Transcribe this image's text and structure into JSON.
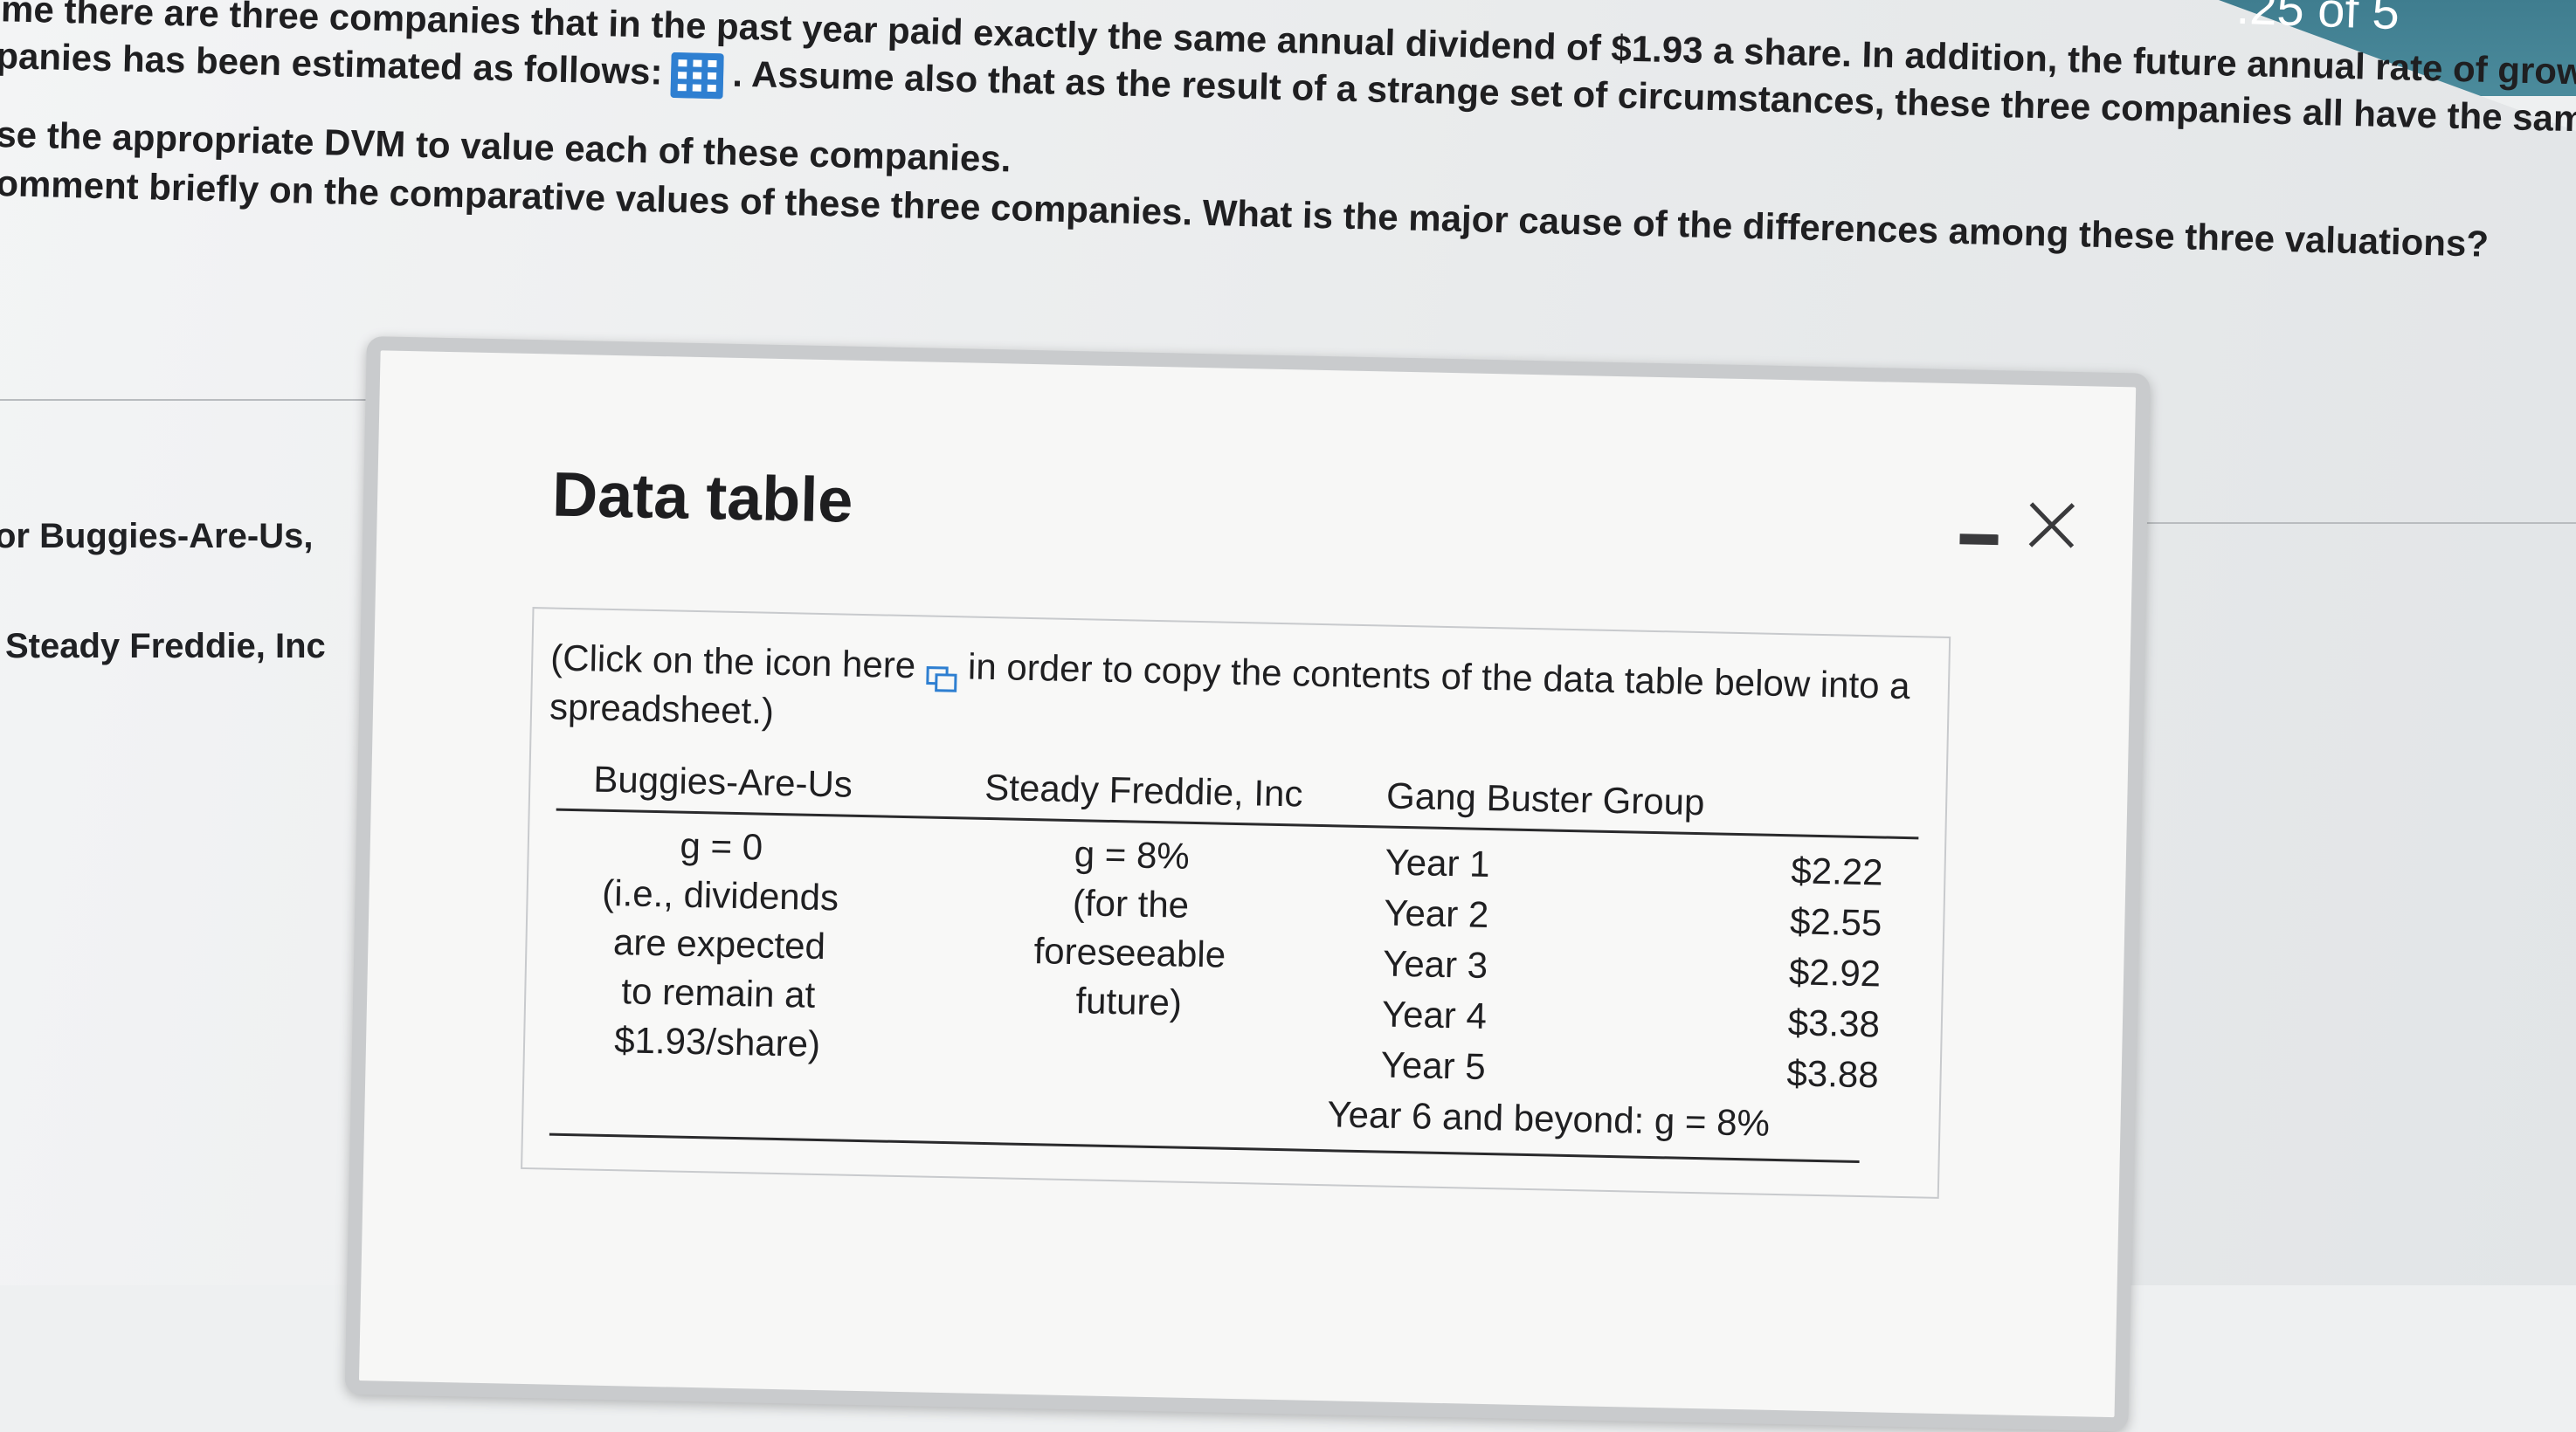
{
  "header": {
    "points": ".25 of 5"
  },
  "question": {
    "lines": [
      "ime there are three companies that in the past year paid exactly the same annual dividend of $1.93 a share. In addition, the future annual rate of grow",
      "panies has been estimated as follows:",
      ". Assume also that as the result of a strange set of circumstances, these three companies all have the same",
      "se the appropriate DVM to value each of these companies.",
      "omment briefly on the comparative values of these three companies. What is the major cause of the differences among these three valuations?"
    ]
  },
  "side": {
    "buggies_label": "or Buggies-Are-Us,",
    "freddie_label": "Steady Freddie, Inc"
  },
  "dialog": {
    "title": "Data table",
    "instructions_pre": "(Click on the icon here",
    "instructions_post": "in order to copy the contents of the data table below into a spreadsheet.)"
  },
  "table": {
    "headers": [
      "Buggies-Are-Us",
      "Steady Freddie, Inc",
      "Gang Buster Group"
    ],
    "buggies": {
      "g": "g = 0",
      "note": [
        "(i.e., dividends",
        "are expected",
        "to remain at",
        "$1.93/share)"
      ]
    },
    "freddie": {
      "g": "g = 8%",
      "note": [
        "(for the",
        "foreseeable",
        "future)"
      ]
    },
    "gang": {
      "rows": [
        {
          "year": "Year 1",
          "value": "$2.22"
        },
        {
          "year": "Year 2",
          "value": "$2.55"
        },
        {
          "year": "Year 3",
          "value": "$2.92"
        },
        {
          "year": "Year 4",
          "value": "$3.38"
        },
        {
          "year": "Year 5",
          "value": "$3.88"
        }
      ],
      "footer": "Year 6 and beyond: g = 8%"
    }
  },
  "colors": {
    "accent_blue": "#2e7fd1",
    "header_strip": "#3f7d8f"
  }
}
